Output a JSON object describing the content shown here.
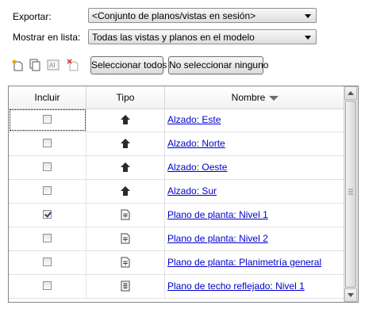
{
  "export": {
    "label": "Exportar:",
    "value": "<Conjunto de planos/vistas en sesión>"
  },
  "show_in_list": {
    "label": "Mostrar en lista:",
    "value": "Todas las vistas y planos en el modelo"
  },
  "toolbar": {
    "icons": [
      "new-set-icon",
      "duplicate-set-icon",
      "rename-set-icon",
      "delete-set-icon"
    ],
    "select_all": "Seleccionar todos",
    "select_none": "No seleccionar ninguno"
  },
  "grid": {
    "columns": [
      "Incluir",
      "Tipo",
      "Nombre"
    ],
    "sort_column": "Nombre",
    "rows": [
      {
        "checked": false,
        "type": "elevation",
        "name": "Alzado: Este"
      },
      {
        "checked": false,
        "type": "elevation",
        "name": "Alzado: Norte"
      },
      {
        "checked": false,
        "type": "elevation",
        "name": "Alzado: Oeste"
      },
      {
        "checked": false,
        "type": "elevation",
        "name": "Alzado: Sur"
      },
      {
        "checked": true,
        "type": "floor-plan",
        "name": "Plano de planta: Nivel 1"
      },
      {
        "checked": false,
        "type": "floor-plan",
        "name": "Plano de planta: Nivel 2"
      },
      {
        "checked": false,
        "type": "floor-plan",
        "name": "Plano de planta: Planimetría general"
      },
      {
        "checked": false,
        "type": "ceiling-plan",
        "name": "Plano de techo reflejado: Nivel 1"
      }
    ]
  }
}
